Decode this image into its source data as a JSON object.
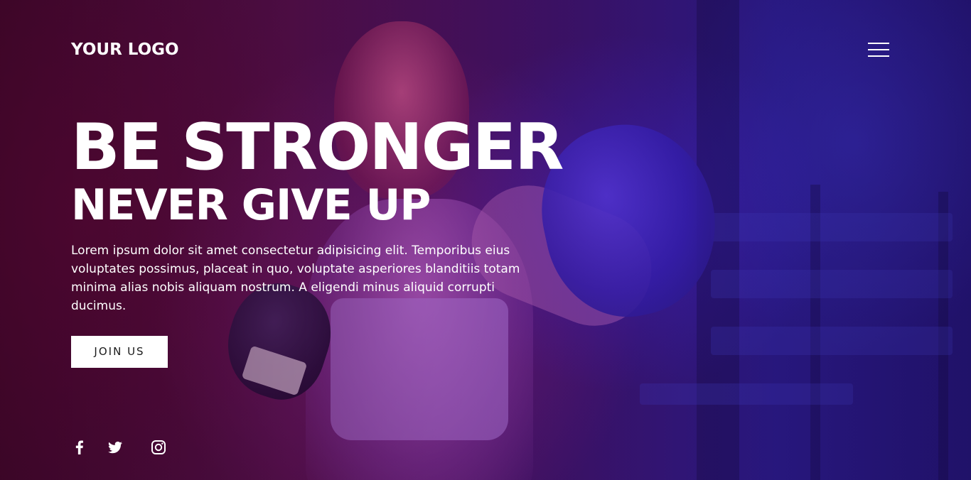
{
  "header": {
    "logo_text": "YOUR LOGO",
    "menu_icon": "hamburger-menu-icon"
  },
  "hero": {
    "title": "BE STRONGER",
    "subtitle": "NEVER GIVE UP",
    "description": "Lorem ipsum dolor sit amet consectetur adipisicing elit. Temporibus eius voluptates possimus, placeat in quo, voluptate asperiores blanditiis totam minima alias nobis aliquam nostrum. A eligendi minus aliquid corrupti ducimus.",
    "cta_label": "JOIN US"
  },
  "social": {
    "items": [
      {
        "icon": "facebook-icon"
      },
      {
        "icon": "twitter-icon"
      },
      {
        "icon": "instagram-icon"
      }
    ]
  },
  "colors": {
    "text": "#ffffff",
    "button_bg": "#ffffff",
    "button_text": "#1a1a1a",
    "overlay_left": "#5a1250",
    "overlay_right": "#2c1a8a"
  }
}
